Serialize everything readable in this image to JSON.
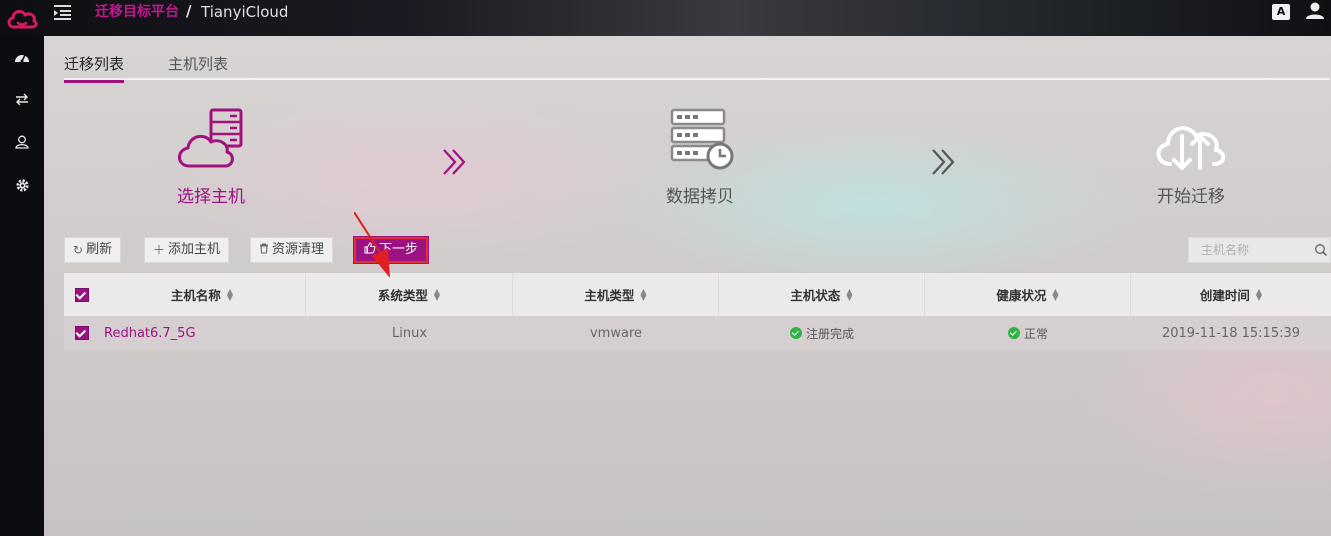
{
  "header": {
    "platform_label": "迁移目标平台",
    "separator": "/",
    "cloud_name": "TianyiCloud",
    "translate_icon_text": "A"
  },
  "colors": {
    "accent": "#9c1282",
    "step_active": "#a0127e",
    "status_ok": "#2fb344",
    "annotation_red": "#e02020"
  },
  "sidebar": {
    "items": [
      {
        "icon": "dashboard-icon"
      },
      {
        "icon": "transfer-icon"
      },
      {
        "icon": "user-icon"
      },
      {
        "icon": "gear-icon"
      }
    ]
  },
  "tabs": [
    {
      "label": "迁移列表",
      "active": true
    },
    {
      "label": "主机列表",
      "active": false
    }
  ],
  "steps": [
    {
      "label": "选择主机",
      "icon": "cloud-server-icon",
      "active": true
    },
    {
      "label": "数据拷贝",
      "icon": "server-clock-icon",
      "active": false
    },
    {
      "label": "开始迁移",
      "icon": "cloud-sync-icon",
      "active": false
    }
  ],
  "toolbar": {
    "refresh_label": "刷新",
    "add_host_label": "添加主机",
    "cleanup_label": "资源清理",
    "next_label": "下一步"
  },
  "search": {
    "placeholder": "主机名称"
  },
  "table": {
    "columns": [
      "主机名称",
      "系统类型",
      "主机类型",
      "主机状态",
      "健康状况",
      "创建时间"
    ],
    "rows": [
      {
        "checked": true,
        "host_name": "Redhat6.7_5G",
        "os_type": "Linux",
        "host_type": "vmware",
        "host_status": "注册完成",
        "health": "正常",
        "created": "2019-11-18 15:15:39"
      }
    ]
  }
}
